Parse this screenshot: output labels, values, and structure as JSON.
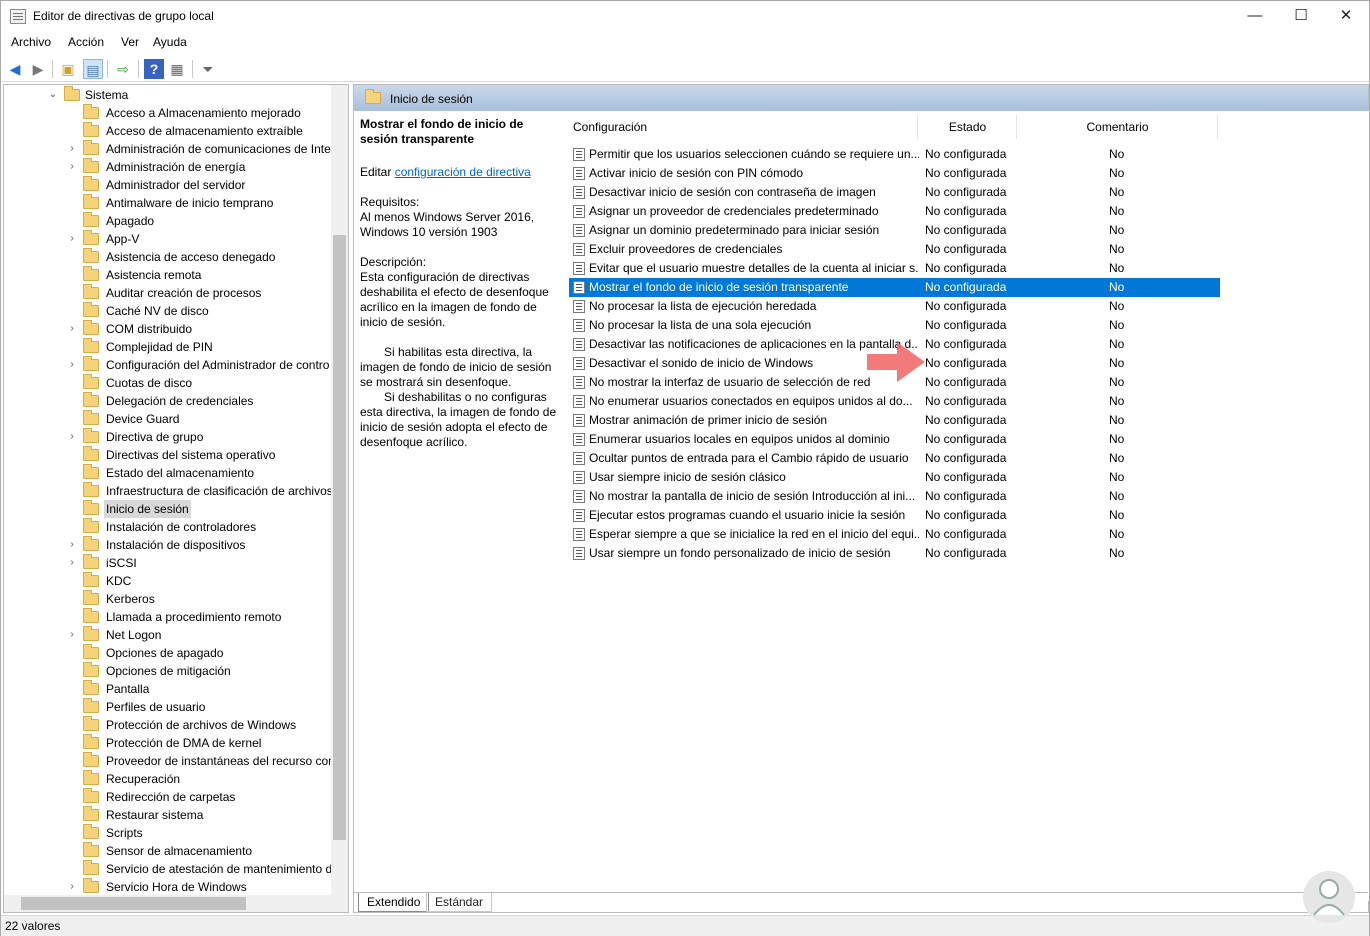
{
  "window": {
    "title": "Editor de directivas de grupo local",
    "controls": [
      "—",
      "☐",
      "✕"
    ]
  },
  "menu": [
    "Archivo",
    "Acción",
    "Ver",
    "Ayuda"
  ],
  "tree": {
    "root": "Sistema",
    "items": [
      {
        "label": "Acceso a Almacenamiento mejorado",
        "expandable": false
      },
      {
        "label": "Acceso de almacenamiento extraíble",
        "expandable": false
      },
      {
        "label": "Administración de comunicaciones de Inte",
        "expandable": true
      },
      {
        "label": "Administración de energía",
        "expandable": true
      },
      {
        "label": "Administrador del servidor",
        "expandable": false
      },
      {
        "label": "Antimalware de inicio temprano",
        "expandable": false
      },
      {
        "label": "Apagado",
        "expandable": false
      },
      {
        "label": "App-V",
        "expandable": true
      },
      {
        "label": "Asistencia de acceso denegado",
        "expandable": false
      },
      {
        "label": "Asistencia remota",
        "expandable": false
      },
      {
        "label": "Auditar creación de procesos",
        "expandable": false
      },
      {
        "label": "Caché NV de disco",
        "expandable": false
      },
      {
        "label": "COM distribuido",
        "expandable": true
      },
      {
        "label": "Complejidad de PIN",
        "expandable": false
      },
      {
        "label": "Configuración del Administrador de contro",
        "expandable": true
      },
      {
        "label": "Cuotas de disco",
        "expandable": false
      },
      {
        "label": "Delegación de credenciales",
        "expandable": false
      },
      {
        "label": "Device Guard",
        "expandable": false
      },
      {
        "label": "Directiva de grupo",
        "expandable": true
      },
      {
        "label": "Directivas del sistema operativo",
        "expandable": false
      },
      {
        "label": "Estado del almacenamiento",
        "expandable": false
      },
      {
        "label": "Infraestructura de clasificación de archivos",
        "expandable": false
      },
      {
        "label": "Inicio de sesión",
        "expandable": false,
        "selected": true
      },
      {
        "label": "Instalación de controladores",
        "expandable": false
      },
      {
        "label": "Instalación de dispositivos",
        "expandable": true
      },
      {
        "label": "iSCSI",
        "expandable": true
      },
      {
        "label": "KDC",
        "expandable": false
      },
      {
        "label": "Kerberos",
        "expandable": false
      },
      {
        "label": "Llamada a procedimiento remoto",
        "expandable": false
      },
      {
        "label": "Net Logon",
        "expandable": true
      },
      {
        "label": "Opciones de apagado",
        "expandable": false
      },
      {
        "label": "Opciones de mitigación",
        "expandable": false
      },
      {
        "label": "Pantalla",
        "expandable": false
      },
      {
        "label": "Perfiles de usuario",
        "expandable": false
      },
      {
        "label": "Protección de archivos de Windows",
        "expandable": false
      },
      {
        "label": "Protección de DMA de kernel",
        "expandable": false
      },
      {
        "label": "Proveedor de instantáneas del recurso com",
        "expandable": false
      },
      {
        "label": "Recuperación",
        "expandable": false
      },
      {
        "label": "Redirección de carpetas",
        "expandable": false
      },
      {
        "label": "Restaurar sistema",
        "expandable": false
      },
      {
        "label": "Scripts",
        "expandable": false
      },
      {
        "label": "Sensor de almacenamiento",
        "expandable": false
      },
      {
        "label": "Servicio de atestación de mantenimiento de",
        "expandable": false
      },
      {
        "label": "Servicio Hora de Windows",
        "expandable": true
      }
    ]
  },
  "right": {
    "header": "Inicio de sesión",
    "desc": {
      "title": "Mostrar el fondo de inicio de sesión transparente",
      "edit_prefix": "Editar",
      "edit_link": "configuración de directiva",
      "req_label": "Requisitos:",
      "req_text": "Al menos Windows Server 2016, Windows 10 versión 1903",
      "desc_label": "Descripción:",
      "desc_p1": "Esta configuración de directivas deshabilita el efecto de desenfoque acrílico en la imagen de fondo de inicio de sesión.",
      "desc_p2": "Si habilitas esta directiva, la imagen de fondo de inicio de sesión se mostrará sin desenfoque.",
      "desc_p3": "Si deshabilitas o no configuras esta directiva, la imagen de fondo de inicio de sesión adopta el efecto de desenfoque acrílico."
    },
    "columns": [
      "Configuración",
      "Estado",
      "Comentario"
    ],
    "rows": [
      {
        "name": "Permitir que los usuarios seleccionen cuándo se requiere un...",
        "state": "No configurada",
        "comment": "No"
      },
      {
        "name": "Activar inicio de sesión con PIN cómodo",
        "state": "No configurada",
        "comment": "No"
      },
      {
        "name": "Desactivar inicio de sesión con contraseña de imagen",
        "state": "No configurada",
        "comment": "No"
      },
      {
        "name": "Asignar un proveedor de credenciales predeterminado",
        "state": "No configurada",
        "comment": "No"
      },
      {
        "name": "Asignar un dominio predeterminado para iniciar sesión",
        "state": "No configurada",
        "comment": "No"
      },
      {
        "name": "Excluir proveedores de credenciales",
        "state": "No configurada",
        "comment": "No"
      },
      {
        "name": "Evitar que el usuario muestre detalles de la cuenta al iniciar s...",
        "state": "No configurada",
        "comment": "No"
      },
      {
        "name": "Mostrar el fondo de inicio de sesión transparente",
        "state": "No configurada",
        "comment": "No",
        "selected": true
      },
      {
        "name": "No procesar la lista de ejecución heredada",
        "state": "No configurada",
        "comment": "No"
      },
      {
        "name": "No procesar la lista de una sola ejecución",
        "state": "No configurada",
        "comment": "No"
      },
      {
        "name": "Desactivar las notificaciones de aplicaciones en la pantalla d...",
        "state": "No configurada",
        "comment": "No"
      },
      {
        "name": "Desactivar el sonido de inicio de Windows",
        "state": "No configurada",
        "comment": "No"
      },
      {
        "name": "No mostrar la interfaz de usuario de selección de red",
        "state": "No configurada",
        "comment": "No"
      },
      {
        "name": "No enumerar usuarios conectados en equipos unidos al do...",
        "state": "No configurada",
        "comment": "No"
      },
      {
        "name": "Mostrar animación de primer inicio de sesión",
        "state": "No configurada",
        "comment": "No"
      },
      {
        "name": "Enumerar usuarios locales en equipos unidos al dominio",
        "state": "No configurada",
        "comment": "No"
      },
      {
        "name": "Ocultar puntos de entrada para el Cambio rápido de usuario",
        "state": "No configurada",
        "comment": "No"
      },
      {
        "name": "Usar siempre inicio de sesión clásico",
        "state": "No configurada",
        "comment": "No"
      },
      {
        "name": "No mostrar la pantalla de inicio de sesión Introducción al ini...",
        "state": "No configurada",
        "comment": "No"
      },
      {
        "name": "Ejecutar estos programas cuando el usuario inicie la sesión",
        "state": "No configurada",
        "comment": "No"
      },
      {
        "name": "Esperar siempre a que se inicialice la red en el inicio del equi...",
        "state": "No configurada",
        "comment": "No"
      },
      {
        "name": "Usar siempre un fondo personalizado de inicio de sesión",
        "state": "No configurada",
        "comment": "No"
      }
    ],
    "tabs": [
      "Extendido",
      "Estándar"
    ]
  },
  "status": "22 valores",
  "colors": {
    "selection": "#0078d7",
    "header": "#a9c0da",
    "arrow": "#f26b6b"
  }
}
